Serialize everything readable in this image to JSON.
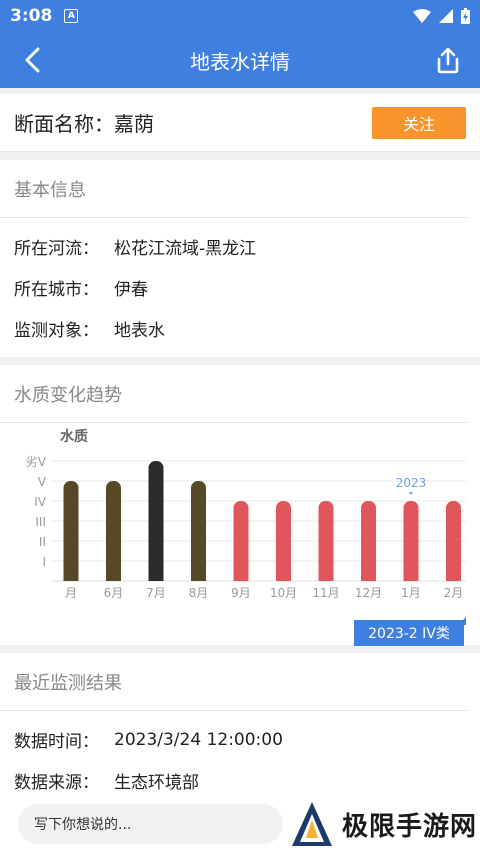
{
  "status": {
    "time": "3:08",
    "badge": "A"
  },
  "appbar": {
    "title": "地表水详情"
  },
  "section_name": {
    "label": "断面名称：嘉荫",
    "follow_label": "关注"
  },
  "basic_info": {
    "title": "基本信息",
    "rows": [
      {
        "key": "所在河流：",
        "value": "松花江流域-黑龙江"
      },
      {
        "key": "所在城市：",
        "value": "伊春"
      },
      {
        "key": "监测对象：",
        "value": "地表水"
      }
    ]
  },
  "trend": {
    "title": "水质变化趋势",
    "tooltip": "2023-2 IV类",
    "chart_data": {
      "type": "bar",
      "ylabel": "水质",
      "y_categories": [
        "I",
        "II",
        "III",
        "IV",
        "V",
        "劣V"
      ],
      "categories": [
        "月",
        "6月",
        "7月",
        "8月",
        "9月",
        "10月",
        "11月",
        "12月",
        "1月",
        "2月"
      ],
      "values": [
        5,
        5,
        6,
        5,
        4,
        4,
        4,
        4,
        4,
        4
      ],
      "bar_colors": [
        "#574828",
        "#574828",
        "#2b2b2b",
        "#574828",
        "#e1565a",
        "#e1565a",
        "#e1565a",
        "#e1565a",
        "#e1565a",
        "#e1565a"
      ],
      "annotation": {
        "label": "2023",
        "category": "1月"
      },
      "grid": true
    }
  },
  "recent": {
    "title": "最近监测结果",
    "rows": [
      {
        "key": "数据时间：",
        "value": "2023/3/24 12:00:00"
      },
      {
        "key": "数据来源：",
        "value": "生态环境部"
      }
    ]
  },
  "bottom": {
    "comment_placeholder": "写下你想说的...",
    "brand": "极限手游网"
  },
  "colors": {
    "primary": "#3f7fe0",
    "accent": "#f7942c"
  }
}
